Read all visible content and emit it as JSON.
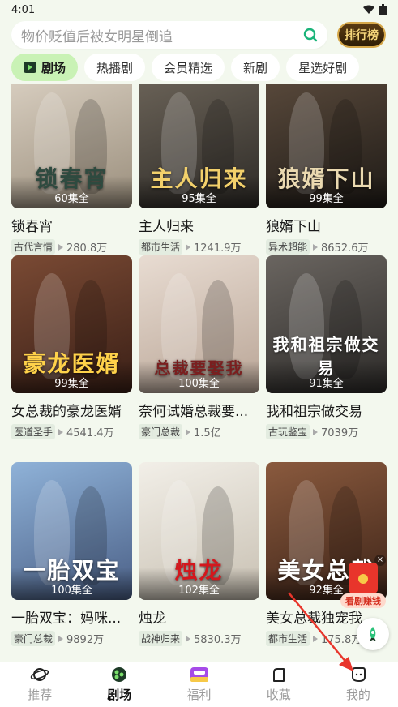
{
  "status_bar": {
    "time": "4:01"
  },
  "search": {
    "placeholder": "物价贬值后被女明星倒追"
  },
  "rank_button": {
    "label": "排行榜"
  },
  "tabs": [
    {
      "label": "剧场"
    },
    {
      "label": "热播剧"
    },
    {
      "label": "会员精选"
    },
    {
      "label": "新剧"
    },
    {
      "label": "星选好剧"
    }
  ],
  "dramas": [
    {
      "title": "锁春宵",
      "episodes": "60集全",
      "tag": "古代言情",
      "views": "280.8万",
      "art": "锁春宵",
      "art_color": "#2e4a3f",
      "bg1": "#d9cfc1",
      "bg2": "#9a8e7c"
    },
    {
      "title": "主人归来",
      "episodes": "95集全",
      "tag": "都市生活",
      "views": "1241.9万",
      "art": "主人归来",
      "art_color": "#f2d06b",
      "bg1": "#6b6358",
      "bg2": "#2d2a26"
    },
    {
      "title": "狼婿下山",
      "episodes": "99集全",
      "tag": "异术超能",
      "views": "8652.6万",
      "art": "狼婿下山",
      "art_color": "#ead9b0",
      "bg1": "#5a4a3c",
      "bg2": "#1e1a16"
    },
    {
      "title": "女总裁的豪龙医婿",
      "episodes": "99集全",
      "tag": "医道圣手",
      "views": "4541.4万",
      "art": "豪龙医婿",
      "art_color": "#ffd24a",
      "bg1": "#7a4a34",
      "bg2": "#3a1f16"
    },
    {
      "title": "奈何试婚总裁要...",
      "episodes": "100集全",
      "tag": "豪门总裁",
      "views": "1.5亿",
      "art": "总裁要娶我",
      "art_color": "#7a1f1f",
      "bg1": "#e8dcd2",
      "bg2": "#b9a596"
    },
    {
      "title": "我和祖宗做交易",
      "episodes": "91集全",
      "tag": "古玩鉴宝",
      "views": "7039万",
      "art": "我和祖宗做交易",
      "art_color": "#ffffff",
      "bg1": "#6a6560",
      "bg2": "#2c2a28"
    },
    {
      "title": "一胎双宝：妈咪...",
      "episodes": "100集全",
      "tag": "豪门总裁",
      "views": "9892万",
      "art": "一胎双宝",
      "art_color": "#ffffff",
      "bg1": "#8fb2d8",
      "bg2": "#4a5f86"
    },
    {
      "title": "烛龙",
      "episodes": "102集全",
      "tag": "战神归来",
      "views": "5830.3万",
      "art": "烛龙",
      "art_color": "#d4171d",
      "bg1": "#f2efe8",
      "bg2": "#c8c0b2"
    },
    {
      "title": "美女总裁独宠我",
      "episodes": "92集全",
      "tag": "都市生活",
      "views": "175.8万",
      "art": "美女总裁",
      "art_color": "#ffffff",
      "bg1": "#8a5a3e",
      "bg2": "#3e2418"
    }
  ],
  "red_packet": {
    "label": "看剧赚钱"
  },
  "bottom_nav": [
    {
      "label": "推荐",
      "icon": "planet-icon"
    },
    {
      "label": "剧场",
      "icon": "theater-icon"
    },
    {
      "label": "福利",
      "icon": "gift-icon"
    },
    {
      "label": "收藏",
      "icon": "bookmark-icon"
    },
    {
      "label": "我的",
      "icon": "profile-icon"
    }
  ],
  "colors": {
    "accent": "#c9f2b5",
    "background": "#f3f8ee",
    "arrow": "#e8352b"
  }
}
